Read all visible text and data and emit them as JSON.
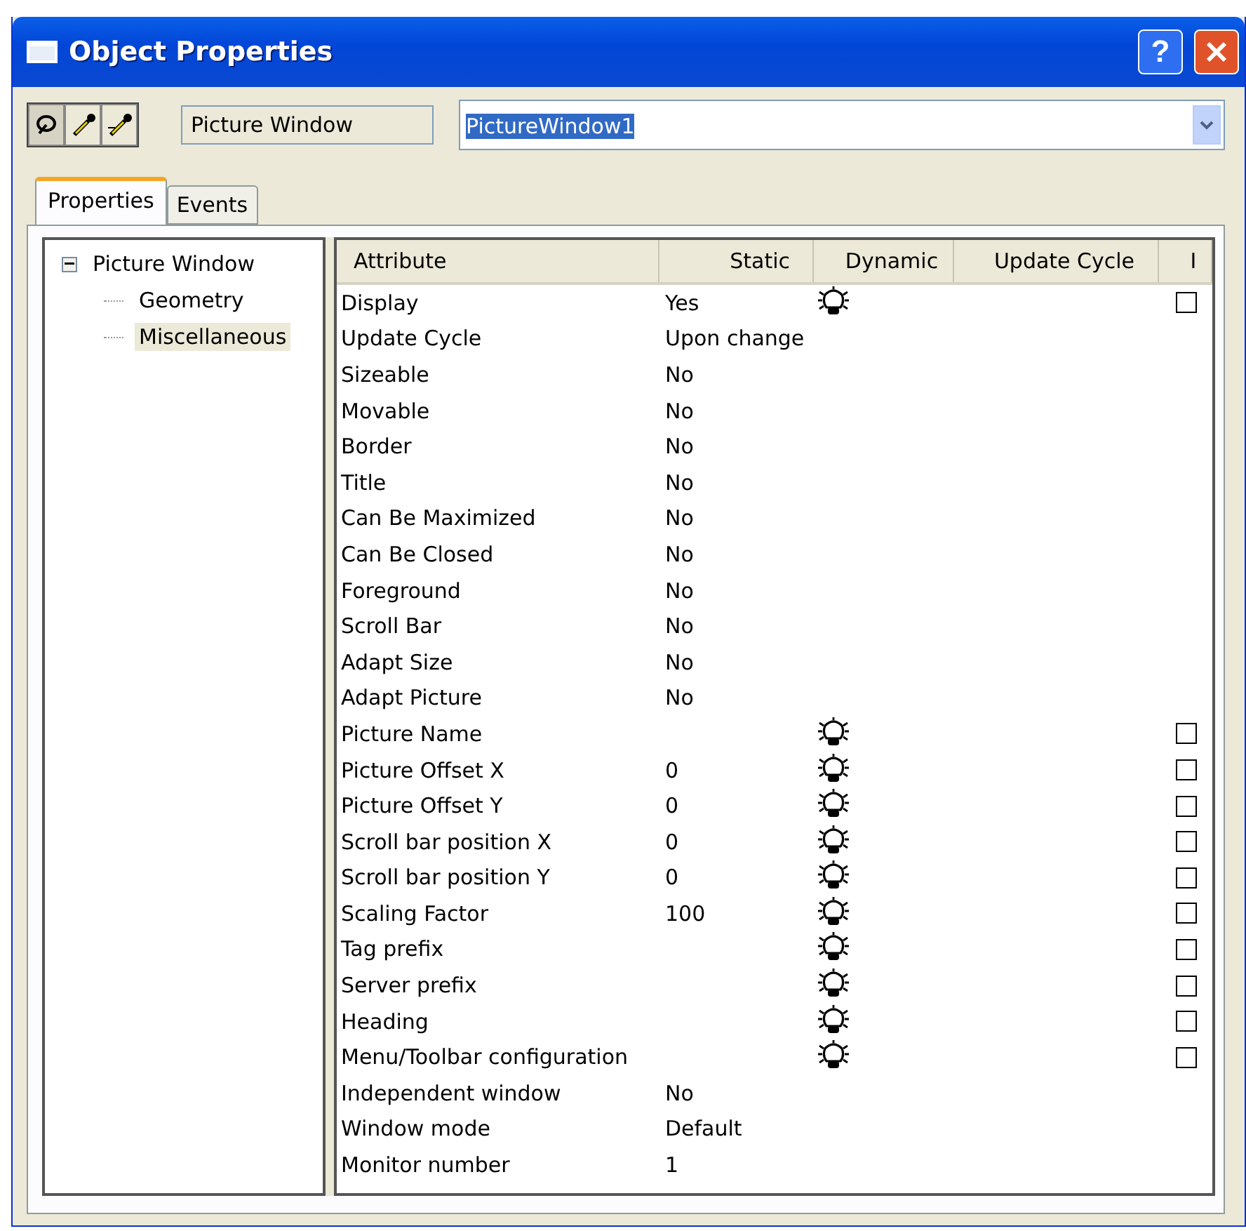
{
  "window": {
    "title": "Object Properties",
    "help": "?"
  },
  "toolbar": {
    "type_label": "Picture Window",
    "object_name": "PictureWindow1"
  },
  "tabs": [
    {
      "label": "Properties",
      "selected": true
    },
    {
      "label": "Events",
      "selected": false
    }
  ],
  "tree": [
    {
      "label": "Picture Window",
      "expanded": true,
      "selected": false,
      "children": [
        {
          "label": "Geometry",
          "selected": false
        },
        {
          "label": "Miscellaneous",
          "selected": true
        }
      ]
    }
  ],
  "table": {
    "columns": [
      "Attribute",
      "Static",
      "Dynamic",
      "Update Cycle",
      "I"
    ],
    "rows": [
      {
        "attribute": "Display",
        "static": "Yes",
        "dynamic": true,
        "checkbox": {
          "checked": false
        }
      },
      {
        "attribute": "Update Cycle",
        "static": "Upon change",
        "dynamic": false
      },
      {
        "attribute": "Sizeable",
        "static": "No",
        "dynamic": false
      },
      {
        "attribute": "Movable",
        "static": "No",
        "dynamic": false
      },
      {
        "attribute": "Border",
        "static": "No",
        "dynamic": false
      },
      {
        "attribute": "Title",
        "static": "No",
        "dynamic": false
      },
      {
        "attribute": "Can Be Maximized",
        "static": "No",
        "dynamic": false
      },
      {
        "attribute": "Can Be Closed",
        "static": "No",
        "dynamic": false
      },
      {
        "attribute": "Foreground",
        "static": "No",
        "dynamic": false
      },
      {
        "attribute": "Scroll Bar",
        "static": "No",
        "dynamic": false
      },
      {
        "attribute": "Adapt Size",
        "static": "No",
        "dynamic": false
      },
      {
        "attribute": "Adapt Picture",
        "static": "No",
        "dynamic": false
      },
      {
        "attribute": "Picture Name",
        "dynamic": true,
        "checkbox": {
          "checked": false
        }
      },
      {
        "attribute": "Picture Offset X",
        "static": "0",
        "dynamic": true,
        "checkbox": {
          "checked": false
        }
      },
      {
        "attribute": "Picture Offset Y",
        "static": "0",
        "dynamic": true,
        "checkbox": {
          "checked": false
        }
      },
      {
        "attribute": "Scroll bar position X",
        "static": "0",
        "dynamic": true,
        "checkbox": {
          "checked": false
        }
      },
      {
        "attribute": "Scroll bar position Y",
        "static": "0",
        "dynamic": true,
        "checkbox": {
          "checked": false
        }
      },
      {
        "attribute": "Scaling Factor",
        "static": "100",
        "dynamic": true,
        "checkbox": {
          "checked": false
        }
      },
      {
        "attribute": "Tag prefix",
        "dynamic": true,
        "checkbox": {
          "checked": false
        }
      },
      {
        "attribute": "Server prefix",
        "dynamic": true,
        "checkbox": {
          "checked": false
        }
      },
      {
        "attribute": "Heading",
        "dynamic": true,
        "checkbox": {
          "checked": false
        }
      },
      {
        "attribute": "Menu/Toolbar configuration",
        "dynamic": true,
        "checkbox": {
          "checked": false
        }
      },
      {
        "attribute": "Independent window",
        "static": "No",
        "dynamic": false
      },
      {
        "attribute": "Window mode",
        "static": "Default",
        "dynamic": false
      },
      {
        "attribute": "Monitor number",
        "static": "1",
        "dynamic": false
      }
    ]
  }
}
